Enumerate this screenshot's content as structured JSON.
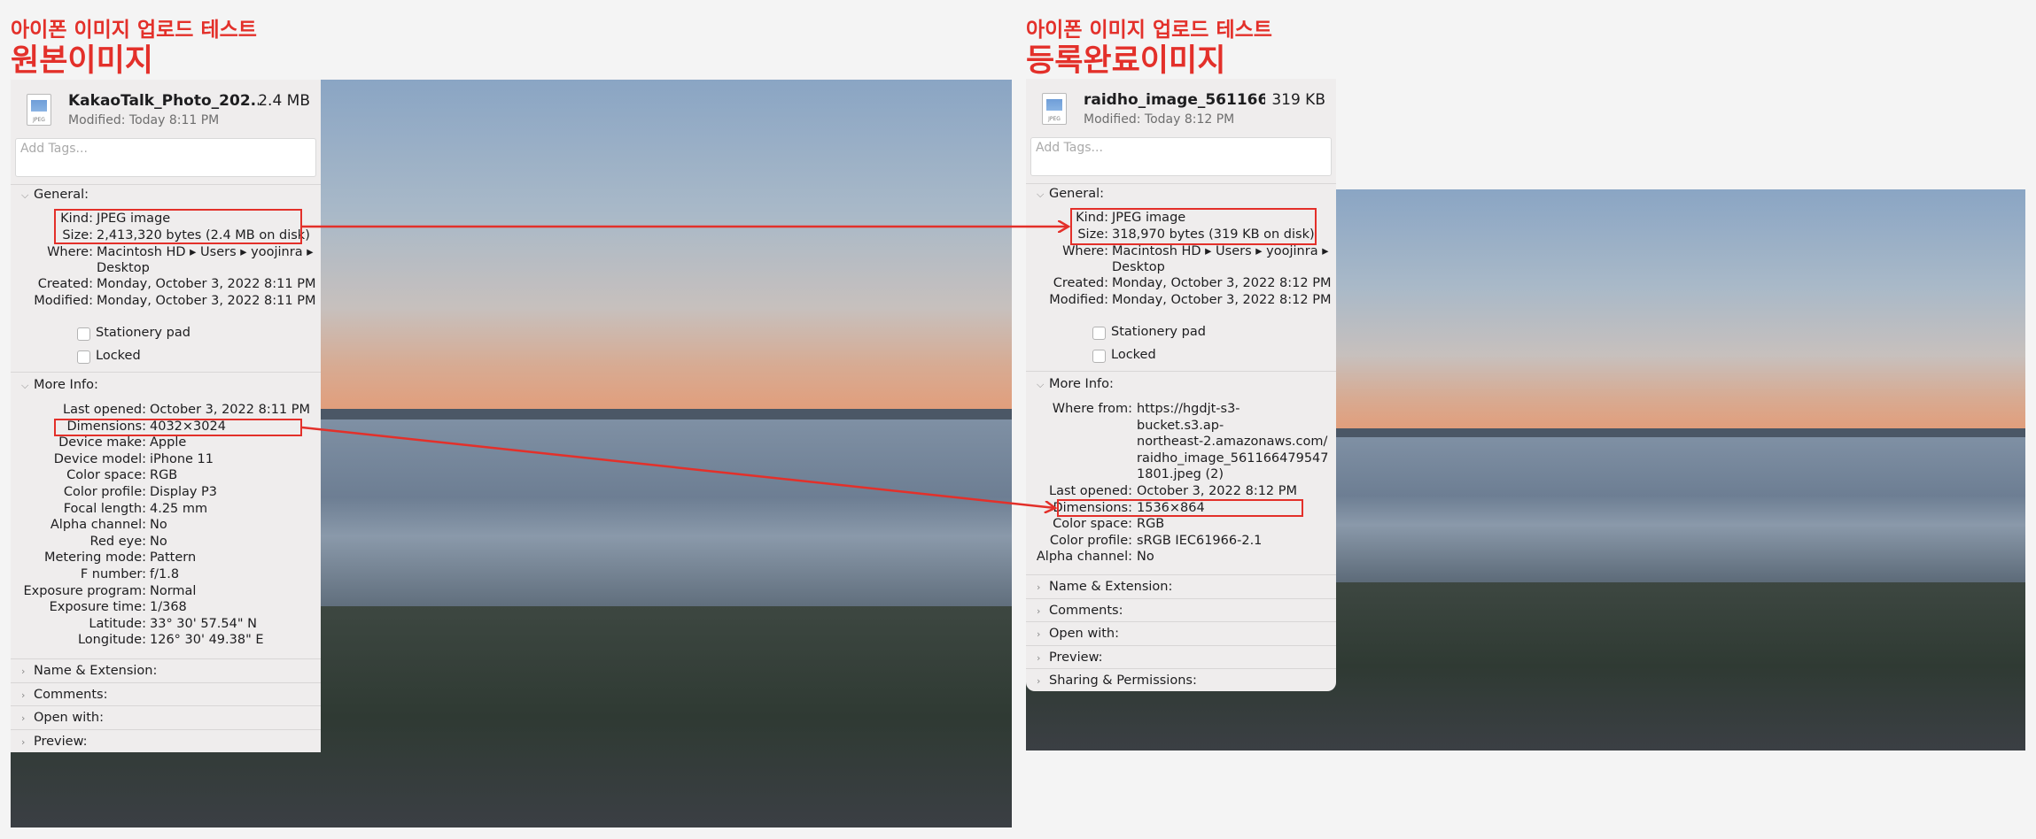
{
  "left": {
    "caption": "아이폰 이미지 업로드 테스트",
    "title": "원본이미지",
    "file": {
      "name": "KakaoTalk_Photo_202...",
      "size": "2.4 MB",
      "modified": "Modified: Today 8:11 PM",
      "icon_label": "JPEG"
    },
    "tags_placeholder": "Add Tags...",
    "general_label": "General:",
    "general": {
      "kind_k": "Kind:",
      "kind_v": "JPEG image",
      "size_k": "Size:",
      "size_v": "2,413,320 bytes (2.4 MB on disk)",
      "where_k": "Where:",
      "where_v1": "Macintosh HD ▸ Users ▸ yoojinra ▸",
      "where_v2": "Desktop",
      "created_k": "Created:",
      "created_v": "Monday, October 3, 2022 8:11 PM",
      "modified_k": "Modified:",
      "modified_v": "Monday, October 3, 2022 8:11 PM"
    },
    "stationery": "Stationery pad",
    "locked": "Locked",
    "more_info_label": "More Info:",
    "more_info": [
      {
        "k": "Last opened:",
        "v": "October 3, 2022 8:11 PM"
      },
      {
        "k": "Dimensions:",
        "v": "4032×3024"
      },
      {
        "k": "Device make:",
        "v": "Apple"
      },
      {
        "k": "Device model:",
        "v": "iPhone 11"
      },
      {
        "k": "Color space:",
        "v": "RGB"
      },
      {
        "k": "Color profile:",
        "v": "Display P3"
      },
      {
        "k": "Focal length:",
        "v": "4.25 mm"
      },
      {
        "k": "Alpha channel:",
        "v": "No"
      },
      {
        "k": "Red eye:",
        "v": "No"
      },
      {
        "k": "Metering mode:",
        "v": "Pattern"
      },
      {
        "k": "F number:",
        "v": "f/1.8"
      },
      {
        "k": "Exposure program:",
        "v": "Normal"
      },
      {
        "k": "Exposure time:",
        "v": "1/368"
      },
      {
        "k": "Latitude:",
        "v": "33° 30' 57.54\" N"
      },
      {
        "k": "Longitude:",
        "v": "126° 30' 49.38\" E"
      }
    ],
    "collapsed": [
      "Name & Extension:",
      "Comments:",
      "Open with:",
      "Preview:"
    ]
  },
  "right": {
    "caption": "아이폰 이미지 업로드 테스트",
    "title": "등록완료이미지",
    "file": {
      "name": "raidho_image_561166...",
      "size": "319 KB",
      "modified": "Modified: Today 8:12 PM",
      "icon_label": "JPEG"
    },
    "tags_placeholder": "Add Tags...",
    "general_label": "General:",
    "general": {
      "kind_k": "Kind:",
      "kind_v": "JPEG image",
      "size_k": "Size:",
      "size_v": "318,970 bytes (319 KB on disk)",
      "where_k": "Where:",
      "where_v1": "Macintosh HD ▸ Users ▸ yoojinra ▸",
      "where_v2": "Desktop",
      "created_k": "Created:",
      "created_v": "Monday, October 3, 2022 8:12 PM",
      "modified_k": "Modified:",
      "modified_v": "Monday, October 3, 2022 8:12 PM"
    },
    "stationery": "Stationery pad",
    "locked": "Locked",
    "more_info_label": "More Info:",
    "where_from_k": "Where from:",
    "where_from_v": [
      "https://hgdjt-s3-",
      "bucket.s3.ap-",
      "northeast-2.amazonaws.com/",
      "raidho_image_561166479547",
      "1801.jpeg (2)"
    ],
    "more_info": [
      {
        "k": "Last opened:",
        "v": "October 3, 2022 8:12 PM"
      },
      {
        "k": "Dimensions:",
        "v": "1536×864"
      },
      {
        "k": "Color space:",
        "v": "RGB"
      },
      {
        "k": "Color profile:",
        "v": "sRGB IEC61966-2.1"
      },
      {
        "k": "Alpha channel:",
        "v": "No"
      }
    ],
    "collapsed": [
      "Name & Extension:",
      "Comments:",
      "Open with:",
      "Preview:",
      "Sharing & Permissions:"
    ]
  },
  "colors": {
    "highlight": "#e3302a",
    "panel": "#efeded"
  }
}
